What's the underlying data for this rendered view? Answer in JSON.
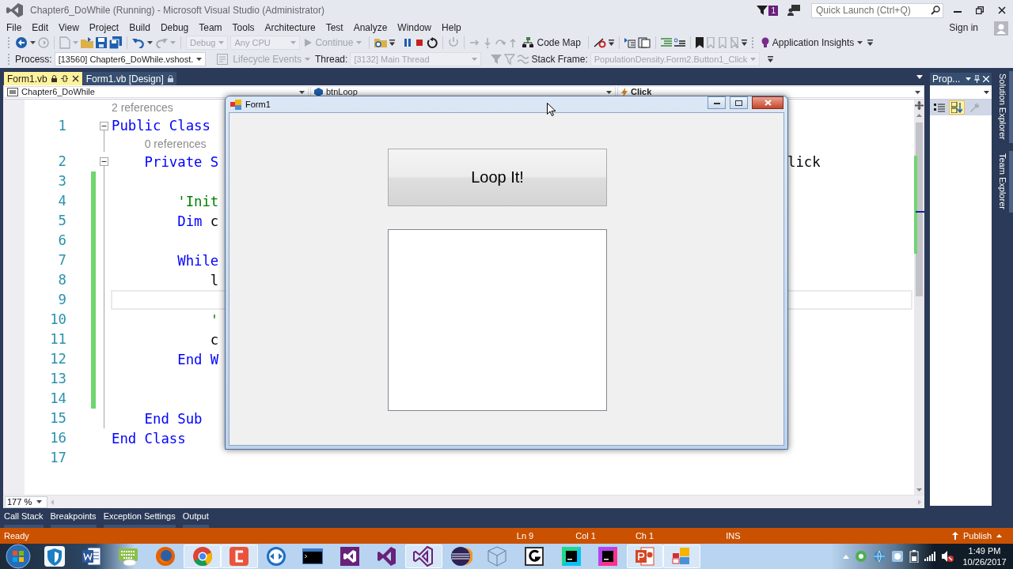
{
  "window": {
    "title": "Chapter6_DoWhile (Running) - Microsoft Visual Studio (Administrator)"
  },
  "notifications": {
    "count": "1"
  },
  "quick_launch": {
    "placeholder": "Quick Launch (Ctrl+Q)"
  },
  "menu": [
    "File",
    "Edit",
    "View",
    "Project",
    "Build",
    "Debug",
    "Team",
    "Tools",
    "Architecture",
    "Test",
    "Analyze",
    "Window",
    "Help"
  ],
  "account": {
    "label": "Sign in"
  },
  "standard_toolbar": {
    "configuration": {
      "text": "Debug",
      "disabled": true
    },
    "platform": {
      "text": "Any CPU",
      "disabled": true
    },
    "continue": {
      "text": "Continue",
      "disabled": true
    },
    "code_map": {
      "text": "Code Map",
      "disabled": false
    },
    "insights": {
      "text": "Application Insights",
      "disabled": false
    }
  },
  "debug_location": {
    "process_label": "Process:",
    "process": {
      "text": "[13560] Chapter6_DoWhile.vshost.",
      "disabled": false
    },
    "lifecycle": {
      "text": "Lifecycle Events",
      "disabled": true
    },
    "thread_label": "Thread:",
    "thread": {
      "text": "[3132] Main Thread",
      "disabled": true
    },
    "stack_frame_label": "Stack Frame:",
    "stack_frame": {
      "text": "PopulationDensity.Form2.Button1_Click",
      "disabled": true
    }
  },
  "document_tabs": [
    {
      "label": "Form1.vb",
      "selected": true
    },
    {
      "label": "Form1.vb [Design]",
      "selected": false
    }
  ],
  "navigation": {
    "project": "Chapter6_DoWhile",
    "member": "btnLoop",
    "event": "Click"
  },
  "code_lines": [
    {
      "number": "1",
      "lens": "2 references",
      "tokens": [
        {
          "text": "Public Class",
          "kind": "keyword"
        }
      ],
      "changed": false,
      "current": false,
      "foldable": true
    },
    {
      "number": "2",
      "lens": "0 references",
      "tokens": [
        {
          "text": "    Private S",
          "kind": "keyword"
        }
      ],
      "text_right": "lick",
      "changed": false,
      "current": false,
      "foldable": true
    },
    {
      "number": "3",
      "changed": true,
      "current": false,
      "foldable": false
    },
    {
      "number": "4",
      "tokens": [
        {
          "text": "        'Init",
          "kind": "comment"
        }
      ],
      "changed": true,
      "current": false,
      "foldable": false
    },
    {
      "number": "5",
      "tokens": [
        {
          "text": "        Dim ",
          "kind": "keyword"
        },
        {
          "text": "c",
          "kind": "plain"
        }
      ],
      "changed": true,
      "current": false,
      "foldable": false
    },
    {
      "number": "6",
      "changed": true,
      "current": false,
      "foldable": false
    },
    {
      "number": "7",
      "tokens": [
        {
          "text": "        While",
          "kind": "keyword"
        }
      ],
      "changed": true,
      "current": false,
      "foldable": false
    },
    {
      "number": "8",
      "tokens": [
        {
          "text": "            l",
          "kind": "plain"
        }
      ],
      "changed": true,
      "current": false,
      "foldable": false
    },
    {
      "number": "9",
      "changed": true,
      "current": true,
      "foldable": false
    },
    {
      "number": "10",
      "tokens": [
        {
          "text": "            '",
          "kind": "comment"
        }
      ],
      "changed": true,
      "current": false,
      "foldable": false
    },
    {
      "number": "11",
      "tokens": [
        {
          "text": "            c",
          "kind": "plain"
        }
      ],
      "changed": true,
      "current": false,
      "foldable": false
    },
    {
      "number": "12",
      "tokens": [
        {
          "text": "        End W",
          "kind": "keyword"
        }
      ],
      "changed": true,
      "current": false,
      "foldable": false
    },
    {
      "number": "13",
      "changed": true,
      "current": false,
      "foldable": false
    },
    {
      "number": "14",
      "changed": true,
      "current": false,
      "foldable": false
    },
    {
      "number": "15",
      "tokens": [
        {
          "text": "    End Sub",
          "kind": "keyword"
        }
      ],
      "changed": false,
      "current": false,
      "foldable": false
    },
    {
      "number": "16",
      "tokens": [
        {
          "text": "End Class",
          "kind": "keyword"
        }
      ],
      "changed": false,
      "current": false,
      "foldable": false
    },
    {
      "number": "17",
      "changed": false,
      "current": false,
      "foldable": false
    }
  ],
  "zoom": "177 %",
  "properties": {
    "title": "Prop...",
    "views": [
      {
        "kind": "categorized",
        "selected": false,
        "disabled": false
      },
      {
        "kind": "alphabetical",
        "selected": true,
        "disabled": false
      },
      {
        "kind": "pages",
        "selected": false,
        "disabled": true
      }
    ]
  },
  "side_tabs": [
    "Solution Explorer",
    "Team Explorer"
  ],
  "tool_tabs": [
    "Call Stack",
    "Breakpoints",
    "Exception Settings",
    "Output"
  ],
  "status_bar": {
    "message": "Ready",
    "line": "Ln 9",
    "column": "Col 1",
    "char": "Ch 1",
    "mode": "INS",
    "publish": "Publish"
  },
  "form": {
    "title": "Form1",
    "button": "Loop It!"
  },
  "taskbar": {
    "apps": [
      {
        "kind": "hp",
        "running": false
      },
      {
        "kind": "word",
        "running": false
      },
      {
        "kind": "keyboard",
        "running": false
      },
      {
        "kind": "firefox",
        "running": false
      },
      {
        "kind": "chrome",
        "running": true
      },
      {
        "kind": "camtasia",
        "running": true
      },
      {
        "kind": "teamviewer",
        "running": false
      },
      {
        "kind": "console",
        "running": false
      },
      {
        "kind": "vs-square",
        "running": false
      },
      {
        "kind": "vs-logo",
        "running": false
      },
      {
        "kind": "vs-outline",
        "running": true
      },
      {
        "kind": "eclipse",
        "running": false
      },
      {
        "kind": "cube",
        "running": false
      },
      {
        "kind": "g-box",
        "running": false
      },
      {
        "kind": "webstorm",
        "running": false
      },
      {
        "kind": "phpstorm",
        "running": false
      },
      {
        "kind": "powerpoint",
        "running": true
      },
      {
        "kind": "blocks",
        "running": true
      }
    ],
    "clock": {
      "time": "1:49 PM",
      "date": "10/26/2017"
    }
  }
}
